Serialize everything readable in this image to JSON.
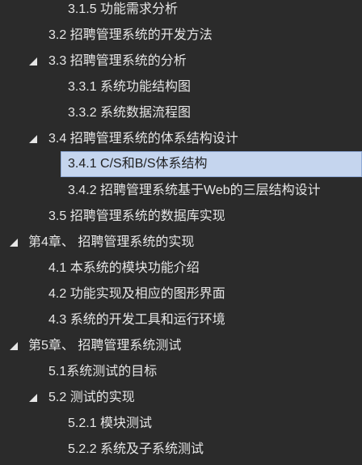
{
  "nav_tree": {
    "items": [
      {
        "label": "3.1.5 功能需求分析"
      },
      {
        "label": "3.2 招聘管理系统的开发方法"
      },
      {
        "label": "3.3 招聘管理系统的分析",
        "expanded": true
      },
      {
        "label": "3.3.1 系统功能结构图"
      },
      {
        "label": "3.3.2 系统数据流程图"
      },
      {
        "label": "3.4 招聘管理系统的体系结构设计",
        "expanded": true
      },
      {
        "label": "3.4.1 C/S和B/S体系结构",
        "selected": true
      },
      {
        "label": "3.4.2 招聘管理系统基于Web的三层结构设计"
      },
      {
        "label": "3.5 招聘管理系统的数据库实现"
      },
      {
        "label": "第4章、 招聘管理系统的实现",
        "expanded": true
      },
      {
        "label": "4.1 本系统的模块功能介绍"
      },
      {
        "label": "4.2 功能实现及相应的图形界面"
      },
      {
        "label": "4.3 系统的开发工具和运行环境"
      },
      {
        "label": "第5章、 招聘管理系统测试",
        "expanded": true
      },
      {
        "label": "5.1系统测试的目标"
      },
      {
        "label": "5.2 测试的实现",
        "expanded": true
      },
      {
        "label": "5.2.1 模块测试"
      },
      {
        "label": "5.2.2 系统及子系统测试"
      }
    ]
  },
  "colors": {
    "background": "#2b2b2b",
    "text": "#e6e6e6",
    "selected_background": "#c5d5ee",
    "selected_border": "#8ea9d6",
    "selected_text": "#1f1f1f",
    "toggle": "#e6e6e6"
  },
  "icons": {
    "expanded_toggle": "triangle-down-right-icon"
  }
}
